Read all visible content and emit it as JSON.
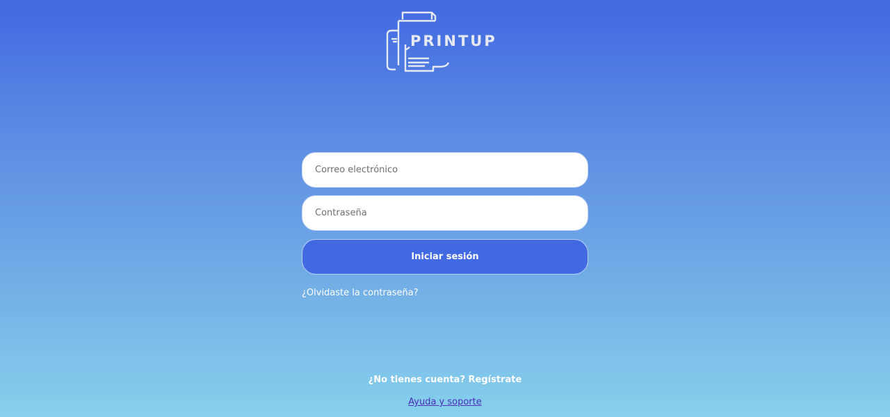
{
  "logo": {
    "text": "PRINTUP",
    "icon": "printer-icon",
    "color": "#e6e9f2"
  },
  "form": {
    "email_placeholder": "Correo electrónico",
    "email_value": "",
    "password_placeholder": "Contraseña",
    "password_value": "",
    "submit_label": "Iniciar sesión"
  },
  "links": {
    "forgot_password": "¿Olvidaste la contraseña?",
    "signup": "¿No tienes cuenta? Regístrate",
    "help": "Ayuda y soporte"
  },
  "colors": {
    "accent": "#4169e1",
    "gradient_top": "#4169e1",
    "gradient_bottom": "#86d0ec",
    "help_link": "#4b2fb8"
  }
}
